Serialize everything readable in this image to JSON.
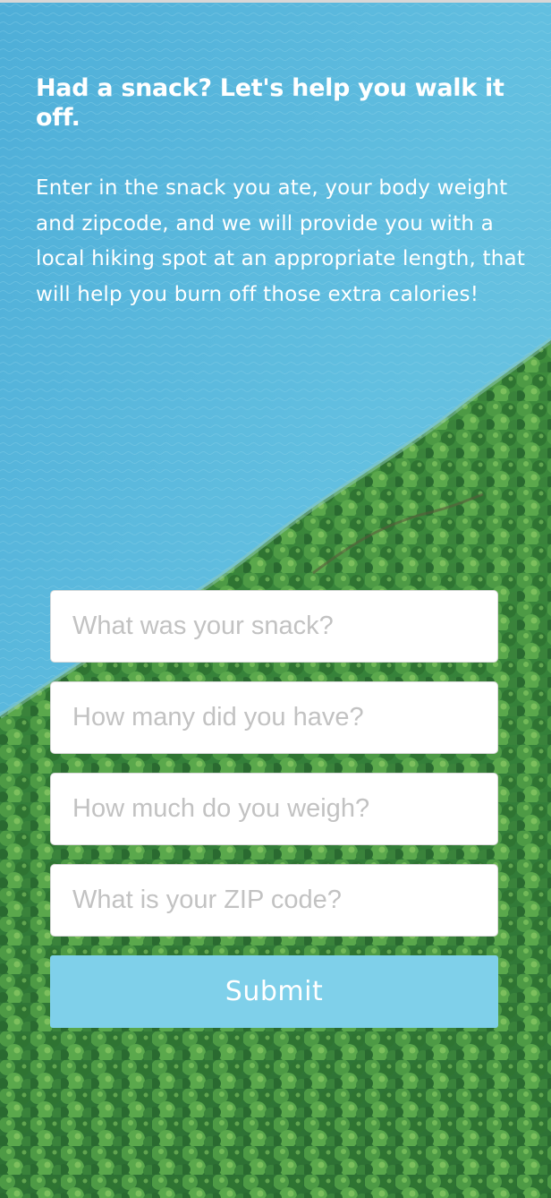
{
  "hero": {
    "heading": "Had a snack? Let's help you walk it off.",
    "description": "Enter in the snack you ate, your body weight and zipcode, and we will provide you with a local hiking spot at an appropriate length, that will help you burn off those extra calories!"
  },
  "form": {
    "snack_placeholder": "What was your snack?",
    "quantity_placeholder": "How many did you have?",
    "weight_placeholder": "How much do you weigh?",
    "zip_placeholder": "What is your ZIP code?",
    "submit_label": "Submit"
  },
  "colors": {
    "water": "#5bb8dc",
    "forest": "#3f8a3a",
    "button": "#7fd0ea",
    "text": "#ffffff"
  }
}
